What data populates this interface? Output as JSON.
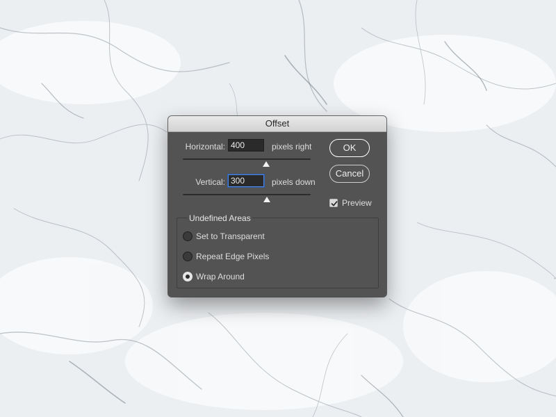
{
  "dialog": {
    "title": "Offset",
    "horizontal": {
      "label": "Horizontal:",
      "value": "400",
      "unit": "pixels right",
      "slider_fraction": 0.65
    },
    "vertical": {
      "label": "Vertical:",
      "value": "300",
      "unit": "pixels down",
      "slider_fraction": 0.66
    },
    "buttons": {
      "ok": "OK",
      "cancel": "Cancel"
    },
    "preview": {
      "label": "Preview",
      "checked": true
    },
    "undefined_areas": {
      "title": "Undefined Areas",
      "options": [
        {
          "label": "Set to Transparent",
          "selected": false
        },
        {
          "label": "Repeat Edge Pixels",
          "selected": false
        },
        {
          "label": "Wrap Around",
          "selected": true
        }
      ]
    }
  },
  "colors": {
    "dialog_bg": "#535353",
    "titlebar_bg": "#dcdcdc",
    "input_bg": "#2a2a2a",
    "focus_ring": "#4f86d9",
    "text": "#dedede"
  }
}
